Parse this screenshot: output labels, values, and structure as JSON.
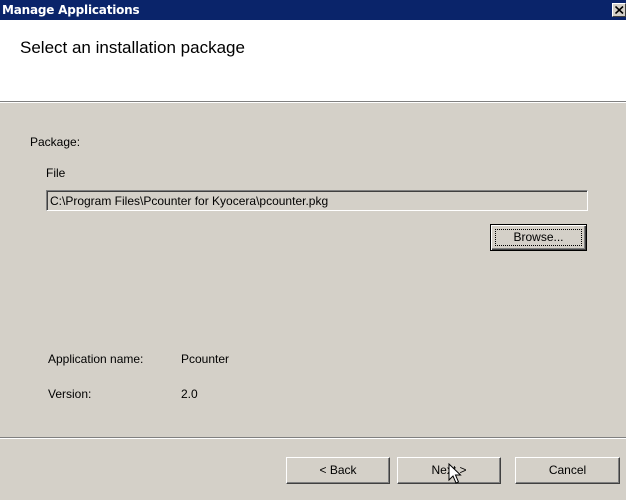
{
  "window": {
    "title": "Manage Applications"
  },
  "header": {
    "heading": "Select an installation package"
  },
  "package": {
    "section_label": "Package:",
    "file_label": "File",
    "file_path": "C:\\Program Files\\Pcounter for Kyocera\\pcounter.pkg",
    "browse_label": "Browse..."
  },
  "info": {
    "app_name_label": "Application name:",
    "app_name_value": "Pcounter",
    "version_label": "Version:",
    "version_value": "2.0"
  },
  "footer": {
    "back_label": "< Back",
    "next_label": "Next >",
    "cancel_label": "Cancel"
  },
  "icons": {
    "close": "close-icon",
    "cursor": "mouse-pointer-icon"
  }
}
